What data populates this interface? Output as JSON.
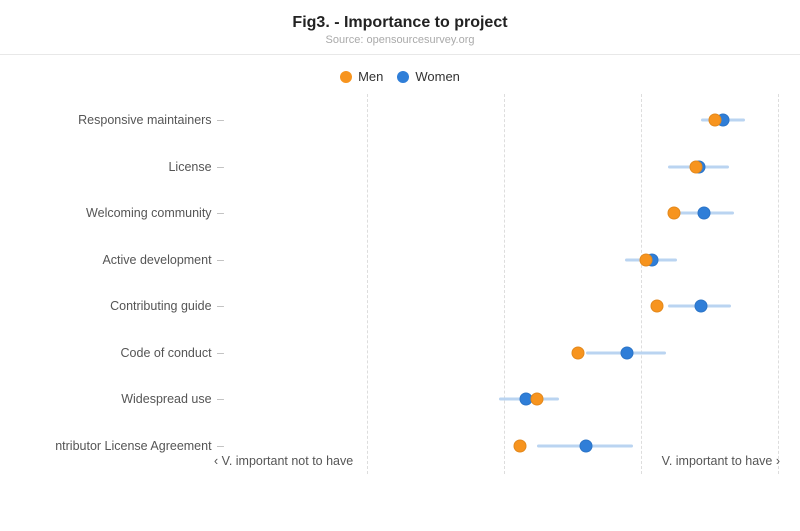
{
  "chart_data": {
    "type": "dot",
    "title": "Fig3. - Importance to project",
    "source_prefix": "Source: ",
    "source": "opensourcesurvey.org",
    "legend": {
      "men": "Men",
      "women": "Women"
    },
    "xlabel_left": "‹ V. important not to have",
    "xlabel_right": "V. important to have ›",
    "x_range": [
      -1,
      1
    ],
    "gridlines_x": [
      -0.5,
      0,
      0.5,
      1.0
    ],
    "categories": [
      "Responsive maintainers",
      "License",
      "Welcoming community",
      "Active development",
      "Contributing guide",
      "Code of conduct",
      "Widespread use",
      "ntributor License Agreement"
    ],
    "series": [
      {
        "name": "Men",
        "color": "#f7941e",
        "values": [
          0.77,
          0.7,
          0.62,
          0.52,
          0.56,
          0.27,
          0.12,
          0.06
        ],
        "ci_lo": null,
        "ci_hi": null
      },
      {
        "name": "Women",
        "color": "#2f7ed8",
        "values": [
          0.8,
          0.71,
          0.73,
          0.54,
          0.72,
          0.45,
          0.08,
          0.3
        ],
        "ci_lo": [
          0.72,
          0.6,
          0.63,
          0.44,
          0.6,
          0.3,
          -0.02,
          0.12
        ],
        "ci_hi": [
          0.88,
          0.82,
          0.84,
          0.63,
          0.83,
          0.59,
          0.2,
          0.47
        ]
      }
    ]
  }
}
